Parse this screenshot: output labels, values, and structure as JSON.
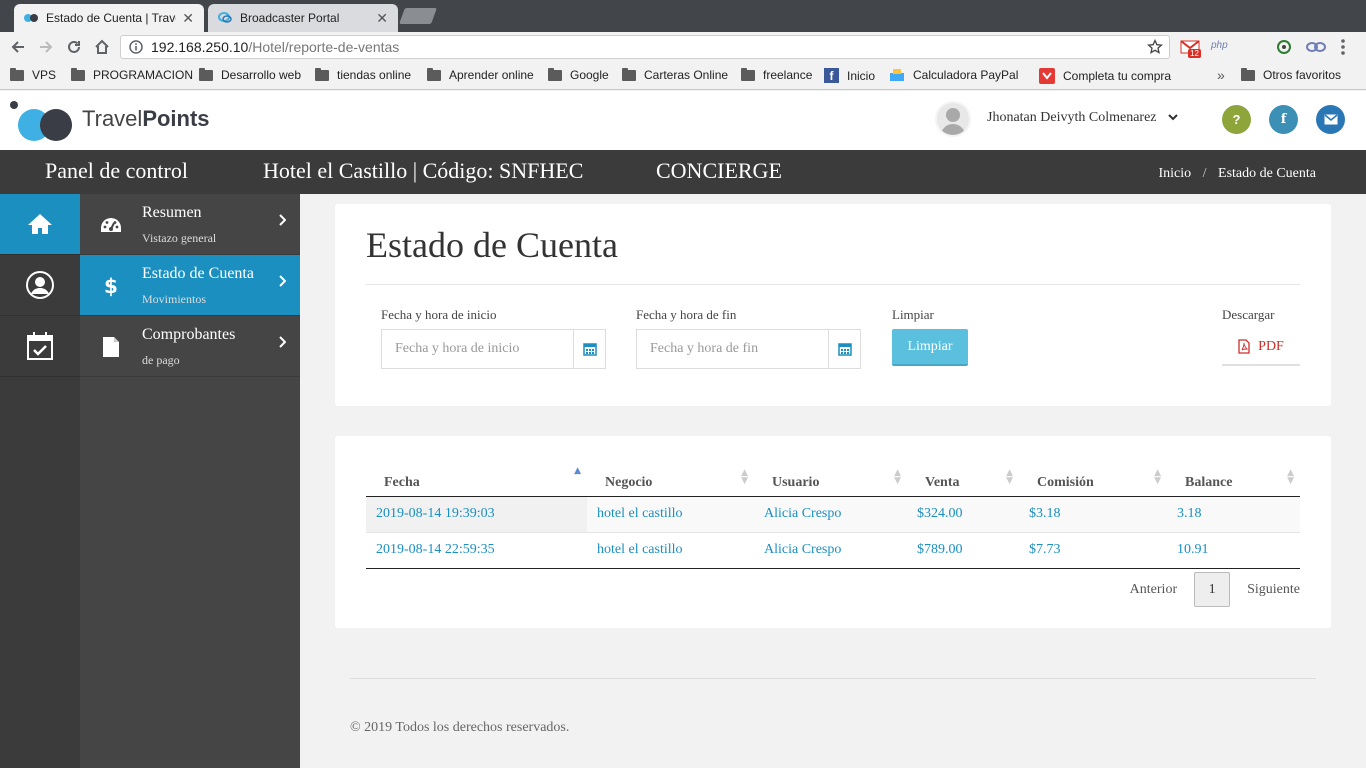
{
  "browser": {
    "tabs": [
      {
        "title": "Estado de Cuenta | Trave",
        "active": true
      },
      {
        "title": "Broadcaster Portal",
        "active": false
      }
    ],
    "url_host": "192.168.250.10",
    "url_path": "/Hotel/reporte-de-ventas",
    "gmail_badge": "12",
    "ext_php": "php",
    "bookmarks": [
      "VPS",
      "PROGRAMACION",
      "Desarrollo web",
      "tiendas online",
      "Aprender online",
      "Google",
      "Carteras Online",
      "freelance",
      "Inicio",
      "Calculadora PayPal",
      "Completa tu compra"
    ],
    "more_bookmarks": "»",
    "other_bookmarks": "Otros favoritos"
  },
  "header": {
    "logo_light": "Travel",
    "logo_bold": "Points",
    "user_name": "Jhonatan Deivyth Colmenarez",
    "help_label": "?",
    "facebook_label": "f",
    "colors": {
      "help": "#8da53a",
      "facebook": "#3c8fb5",
      "mail": "#2a77b5"
    }
  },
  "darkbar": {
    "panel": "Panel de control",
    "hotel": "Hotel el Castillo | Código: SNFHEC",
    "role": "CONCIERGE",
    "breadcrumb": {
      "home": "Inicio",
      "sep": "/",
      "current": "Estado de Cuenta"
    }
  },
  "sidebar": {
    "items": [
      {
        "title": "Resumen",
        "subtitle": "Vistazo general",
        "icon": "dashboard-icon"
      },
      {
        "title": "Estado de Cuenta",
        "subtitle": "Movimientos",
        "icon": "dollar-icon",
        "active": true
      },
      {
        "title": "Comprobantes",
        "subtitle": "de pago",
        "icon": "file-icon"
      }
    ]
  },
  "filters": {
    "title": "Estado de Cuenta",
    "start_label": "Fecha y hora de inicio",
    "start_placeholder": "Fecha y hora de inicio",
    "end_label": "Fecha y hora de fin",
    "end_placeholder": "Fecha y hora de fin",
    "clear_label": "Limpiar",
    "clear_button": "Limpiar",
    "download_label": "Descargar",
    "pdf_button": "PDF"
  },
  "table": {
    "columns": [
      "Fecha",
      "Negocio",
      "Usuario",
      "Venta",
      "Comisión",
      "Balance"
    ],
    "rows": [
      [
        "2019-08-14 19:39:03",
        "hotel el castillo",
        "Alicia Crespo",
        "$324.00",
        "$3.18",
        "3.18"
      ],
      [
        "2019-08-14 22:59:35",
        "hotel el castillo",
        "Alicia Crespo",
        "$789.00",
        "$7.73",
        "10.91"
      ]
    ],
    "pager": {
      "prev": "Anterior",
      "page": "1",
      "next": "Siguiente"
    }
  },
  "footer": {
    "copyright": "© 2019 Todos los derechos reservados."
  }
}
